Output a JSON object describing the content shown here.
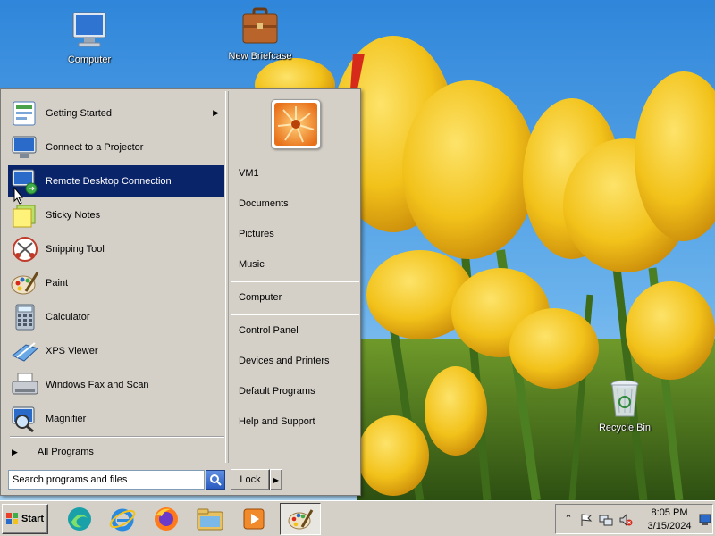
{
  "desktop": {
    "icons": [
      {
        "label": "Computer",
        "icon": "computer-icon"
      },
      {
        "label": "New Briefcase",
        "icon": "briefcase-icon"
      },
      {
        "label": "Recycle Bin",
        "icon": "recycle-bin-icon"
      }
    ]
  },
  "start_menu": {
    "programs": [
      {
        "label": "Getting Started",
        "icon": "getting-started-icon",
        "has_submenu": true
      },
      {
        "label": "Connect to a Projector",
        "icon": "projector-icon"
      },
      {
        "label": "Remote Desktop Connection",
        "icon": "remote-desktop-icon",
        "selected": true
      },
      {
        "label": "Sticky Notes",
        "icon": "sticky-notes-icon"
      },
      {
        "label": "Snipping Tool",
        "icon": "snipping-tool-icon"
      },
      {
        "label": "Paint",
        "icon": "paint-icon"
      },
      {
        "label": "Calculator",
        "icon": "calculator-icon"
      },
      {
        "label": "XPS Viewer",
        "icon": "xps-viewer-icon"
      },
      {
        "label": "Windows Fax and Scan",
        "icon": "fax-scan-icon"
      },
      {
        "label": "Magnifier",
        "icon": "magnifier-icon"
      }
    ],
    "all_programs": "All Programs",
    "places": [
      {
        "label": "VM1"
      },
      {
        "label": "Documents"
      },
      {
        "label": "Pictures"
      },
      {
        "label": "Music"
      },
      {
        "label": "Computer"
      },
      {
        "label": "Control Panel"
      },
      {
        "label": "Devices and Printers"
      },
      {
        "label": "Default Programs"
      },
      {
        "label": "Help and Support"
      }
    ],
    "search": {
      "value": "Search programs and files",
      "icon": "search-icon"
    },
    "lock_label": "Lock"
  },
  "taskbar": {
    "start_label": "Start",
    "pinned": [
      {
        "icon": "edge-copilot-icon"
      },
      {
        "icon": "internet-explorer-icon"
      },
      {
        "icon": "firefox-icon"
      },
      {
        "icon": "file-explorer-icon"
      },
      {
        "icon": "media-player-icon"
      },
      {
        "icon": "paint-icon",
        "active": true
      }
    ],
    "tray": {
      "icons": [
        "chevron-up-icon",
        "flag-icon",
        "network-icon",
        "volume-muted-icon"
      ],
      "time": "8:05 PM",
      "date": "3/15/2024"
    }
  },
  "colors": {
    "menu_face": "#d4d0c8",
    "selection": "#0a246a",
    "sky": "#3c8fd8",
    "tulip": "#f2c21a"
  }
}
